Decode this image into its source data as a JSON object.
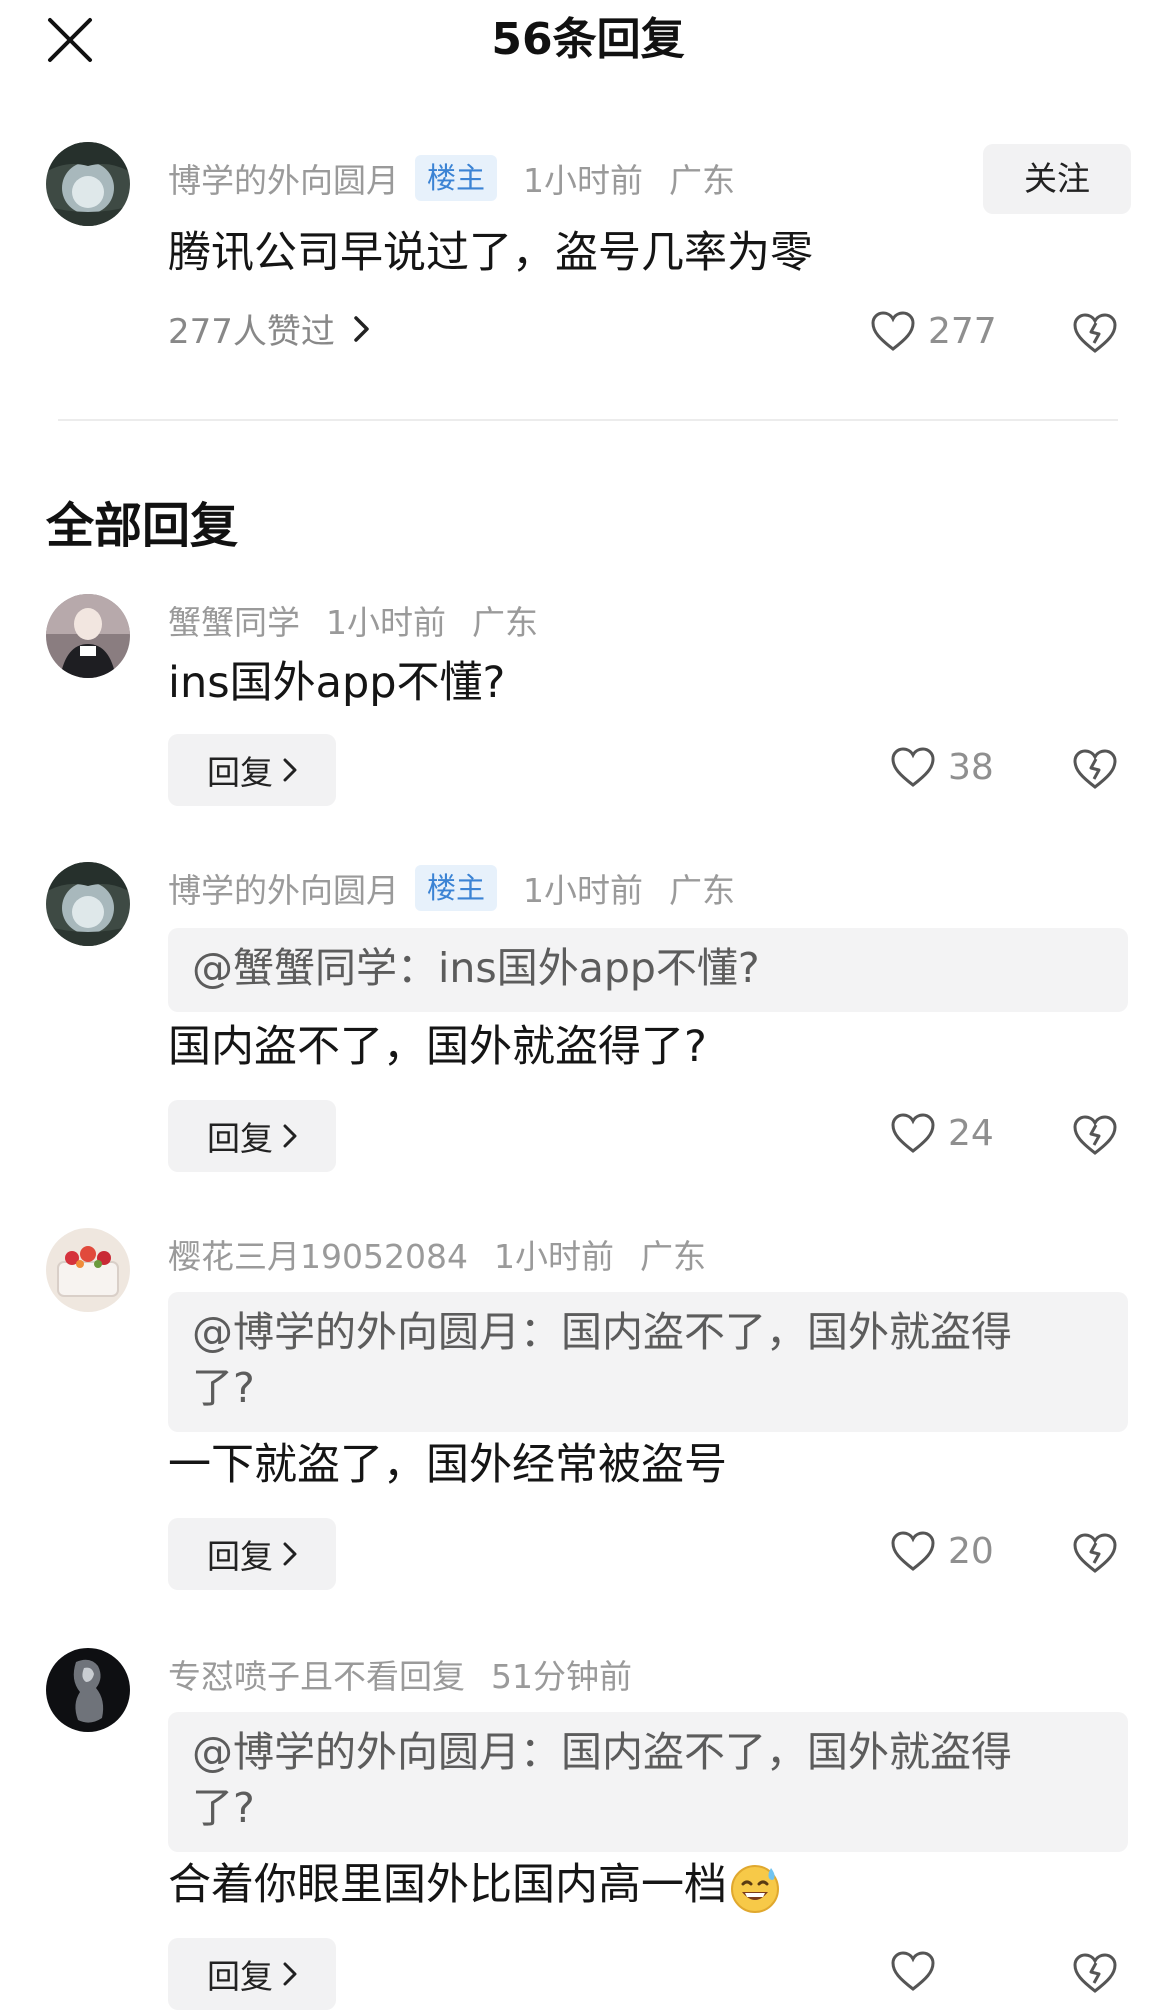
{
  "header": {
    "title": "56条回复"
  },
  "main_comment": {
    "username": "博学的外向圆月",
    "badge": "楼主",
    "time": "1小时前",
    "location": "广东",
    "follow_label": "关注",
    "text": "腾讯公司早说过了，盗号几率为零",
    "likes_summary": "277人赞过",
    "like_count": "277"
  },
  "section_title": "全部回复",
  "replies": [
    {
      "username": "蟹蟹同学",
      "time": "1小时前",
      "location": "广东",
      "text": "ins国外app不懂?",
      "reply_label": "回复",
      "like_count": "38"
    },
    {
      "username": "博学的外向圆月",
      "badge": "楼主",
      "time": "1小时前",
      "location": "广东",
      "quote": "@蟹蟹同学：ins国外app不懂?",
      "text": "国内盗不了，国外就盗得了?",
      "reply_label": "回复",
      "like_count": "24"
    },
    {
      "username": "樱花三月19052084",
      "time": "1小时前",
      "location": "广东",
      "quote_line1": "@博学的外向圆月：国内盗不了，国外就盗得",
      "quote_line2": "了?",
      "text": "一下就盗了，国外经常被盗号",
      "reply_label": "回复",
      "like_count": "20"
    },
    {
      "username": "专怼喷子且不看回复",
      "time": "51分钟前",
      "quote_line1": "@博学的外向圆月：国内盗不了，国外就盗得",
      "quote_line2": "了?",
      "text": "合着你眼里国外比国内高一档",
      "emoji": "sweat-smile-emoji",
      "reply_label": "回复"
    }
  ],
  "colors": {
    "badge_bg": "#e7f1fb",
    "badge_text": "#3b83d4",
    "muted_text": "#9a9a9a",
    "button_bg": "#f2f2f3"
  }
}
